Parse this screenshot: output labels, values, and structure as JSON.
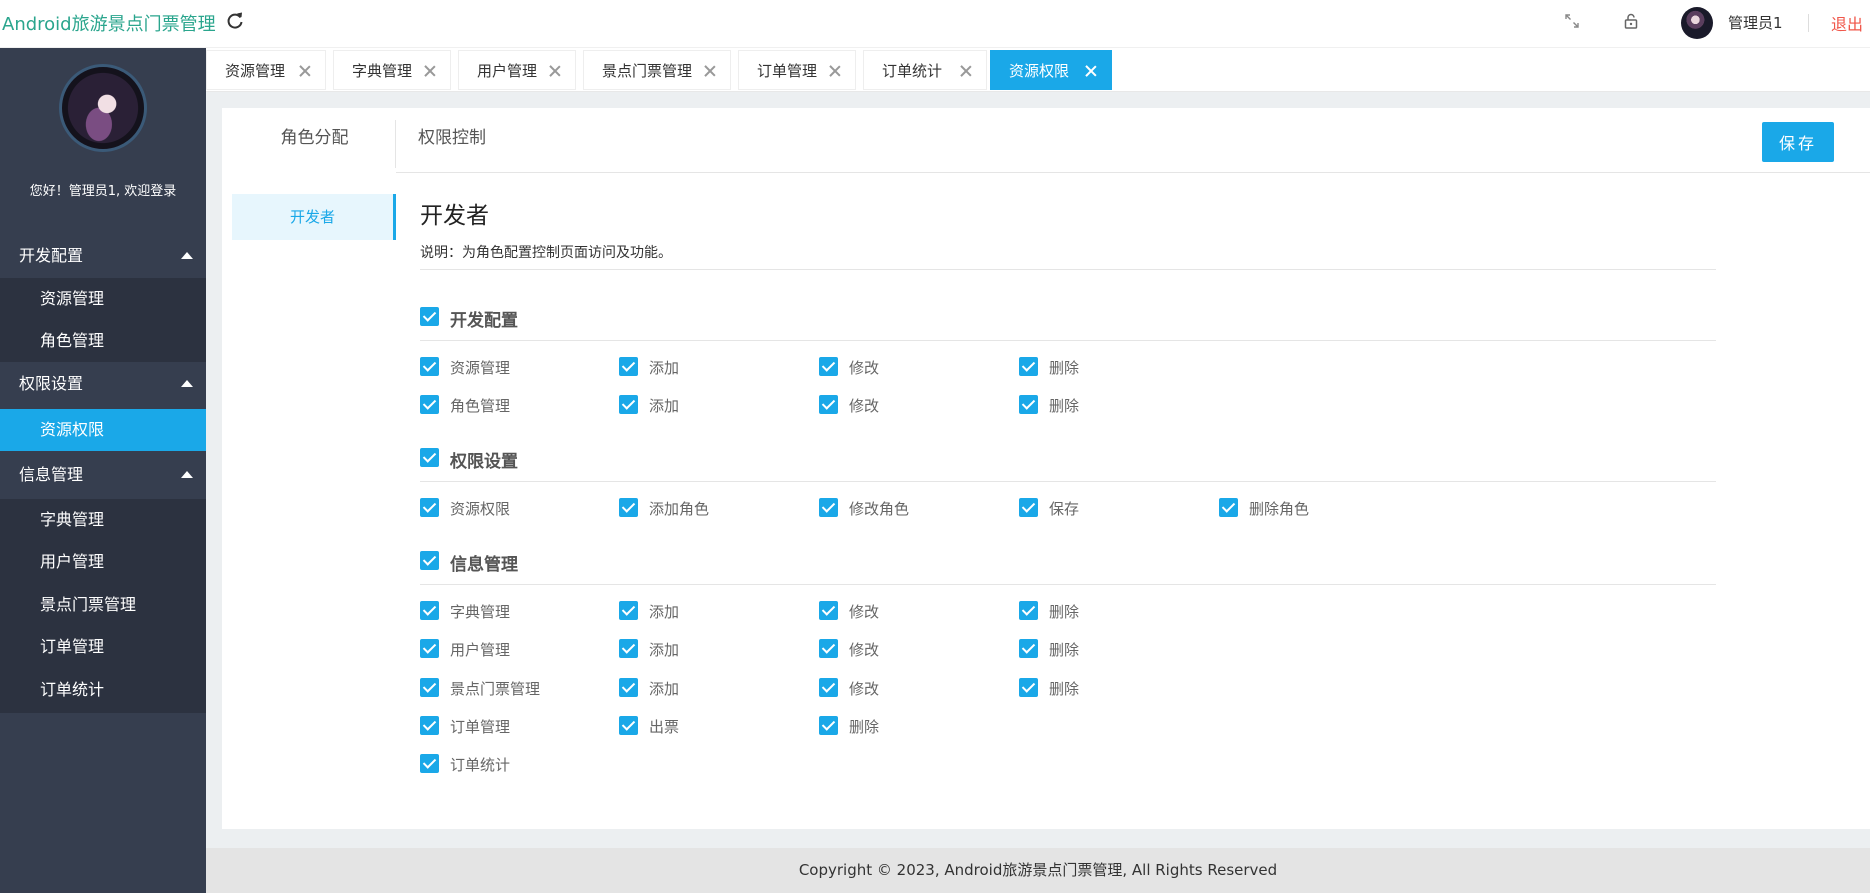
{
  "header": {
    "app_title": "Android旅游景点门票管理",
    "user_name": "管理员1",
    "logout_label": "退出",
    "icons": [
      "refresh-icon",
      "fullscreen-icon",
      "lock-icon"
    ]
  },
  "sidebar": {
    "welcome": "您好！管理员1, 欢迎登录",
    "groups": [
      {
        "label": "开发配置",
        "items": [
          "资源管理",
          "角色管理"
        ]
      },
      {
        "label": "权限设置",
        "items": [
          "资源权限"
        ]
      },
      {
        "label": "信息管理",
        "items": [
          "字典管理",
          "用户管理",
          "景点门票管理",
          "订单管理",
          "订单统计"
        ]
      }
    ],
    "active_item": "资源权限"
  },
  "tabs": [
    {
      "label": "资源管理",
      "active": false
    },
    {
      "label": "字典管理",
      "active": false
    },
    {
      "label": "用户管理",
      "active": false
    },
    {
      "label": "景点门票管理",
      "active": false
    },
    {
      "label": "订单管理",
      "active": false
    },
    {
      "label": "订单统计",
      "active": false
    },
    {
      "label": "资源权限",
      "active": true
    }
  ],
  "main": {
    "role_tab_label": "角色分配",
    "perm_tab_label": "权限控制",
    "save_label": "保存",
    "roles": [
      "开发者"
    ],
    "selected_role": "开发者",
    "description": "说明：为角色配置控制页面访问及功能。",
    "sections": [
      {
        "title": "开发配置",
        "rows": [
          [
            "资源管理",
            "添加",
            "修改",
            "删除"
          ],
          [
            "角色管理",
            "添加",
            "修改",
            "删除"
          ]
        ]
      },
      {
        "title": "权限设置",
        "rows": [
          [
            "资源权限",
            "添加角色",
            "修改角色",
            "保存",
            "删除角色"
          ]
        ]
      },
      {
        "title": "信息管理",
        "rows": [
          [
            "字典管理",
            "添加",
            "修改",
            "删除"
          ],
          [
            "用户管理",
            "添加",
            "修改",
            "删除"
          ],
          [
            "景点门票管理",
            "添加",
            "修改",
            "删除"
          ],
          [
            "订单管理",
            "出票",
            "删除"
          ],
          [
            "订单统计"
          ]
        ]
      }
    ]
  },
  "footer": {
    "copyright": "Copyright © 2023, Android旅游景点门票管理, All Rights Reserved"
  },
  "colors": {
    "accent": "#1aa8e8",
    "brand": "#2aa58d",
    "sidebar_bg": "#363e4f",
    "sidebar_sub_bg": "#2c3240",
    "logout": "#f0574a"
  }
}
